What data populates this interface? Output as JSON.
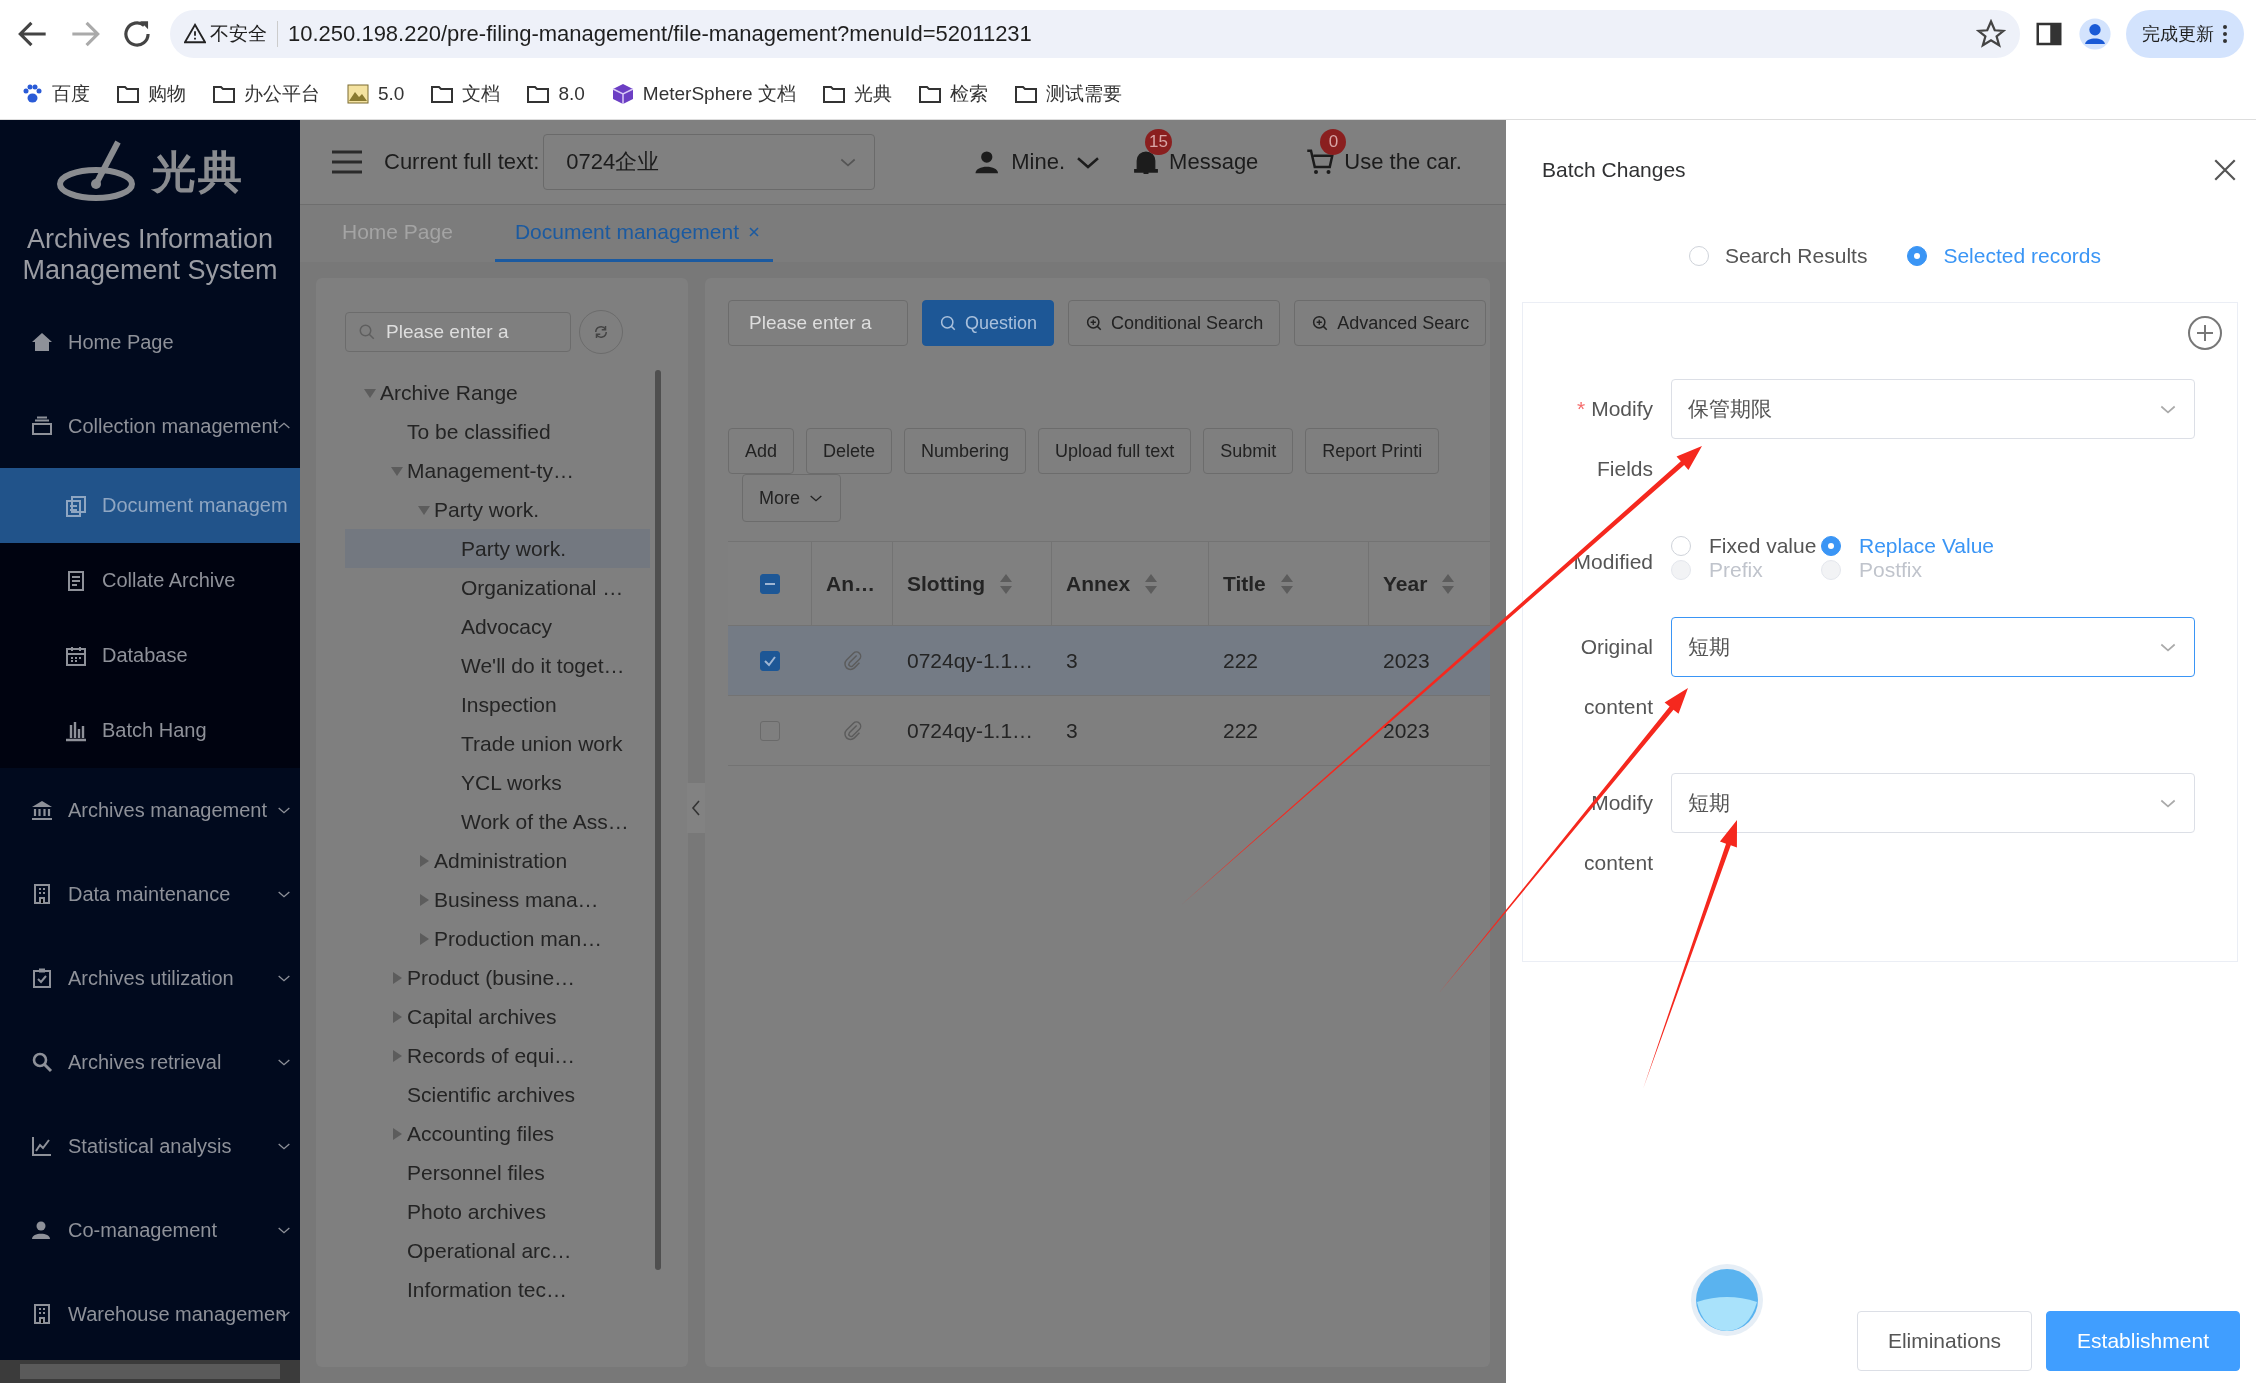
{
  "browser": {
    "security_label": "不安全",
    "url": "10.250.198.220/pre-filing-management/file-management?menuId=52011231",
    "update_button": "完成更新"
  },
  "bookmarks": [
    {
      "label": "百度",
      "kind": "paw"
    },
    {
      "label": "购物",
      "kind": "folder"
    },
    {
      "label": "办公平台",
      "kind": "folder"
    },
    {
      "label": "5.0",
      "kind": "image"
    },
    {
      "label": "文档",
      "kind": "folder"
    },
    {
      "label": "8.0",
      "kind": "folder"
    },
    {
      "label": "MeterSphere 文档",
      "kind": "cube"
    },
    {
      "label": "光典",
      "kind": "folder"
    },
    {
      "label": "检索",
      "kind": "folder"
    },
    {
      "label": "测试需要",
      "kind": "folder"
    }
  ],
  "sidebar": {
    "logo_text": "光典",
    "title": "Archives Information Management System",
    "items": [
      {
        "label": "Home Page",
        "kind": "link",
        "selected": false
      },
      {
        "label": "Collection management",
        "kind": "group",
        "selected": false,
        "expanded": true,
        "children": [
          {
            "label": "Document managem",
            "selected": true
          },
          {
            "label": "Collate Archive",
            "selected": false
          },
          {
            "label": "Database",
            "selected": false
          },
          {
            "label": "Batch Hang",
            "selected": false
          }
        ]
      },
      {
        "label": "Archives management",
        "kind": "group",
        "selected": false,
        "expanded": false
      },
      {
        "label": "Data maintenance",
        "kind": "group",
        "selected": false,
        "expanded": false
      },
      {
        "label": "Archives utilization",
        "kind": "group",
        "selected": false,
        "expanded": false
      },
      {
        "label": "Archives retrieval",
        "kind": "group",
        "selected": false,
        "expanded": false
      },
      {
        "label": "Statistical analysis",
        "kind": "group",
        "selected": false,
        "expanded": false
      },
      {
        "label": "Co-management",
        "kind": "group",
        "selected": false,
        "expanded": false
      },
      {
        "label": "Warehouse managemen",
        "kind": "group",
        "selected": false,
        "expanded": false
      }
    ]
  },
  "header": {
    "full_text_label": "Current full text:",
    "full_text_value": "0724企业",
    "user": "Mine.",
    "message_count": "15",
    "message_label": "Message",
    "cart_count": "0",
    "cart_label": "Use the car."
  },
  "tabs": [
    {
      "label": "Home Page",
      "selected": false
    },
    {
      "label": "Document management",
      "selected": true
    }
  ],
  "tree": {
    "search_placeholder": "Please enter a",
    "nodes": [
      {
        "label": "Archive Range",
        "expanded": true,
        "selected": false,
        "children": [
          {
            "label": "To be classified",
            "selected": false
          },
          {
            "label": "Management-ty…",
            "expanded": true,
            "selected": false,
            "children": [
              {
                "label": "Party work.",
                "expanded": true,
                "selected": false,
                "children": [
                  {
                    "label": "Party work.",
                    "selected": true
                  },
                  {
                    "label": "Organizational …",
                    "selected": false
                  },
                  {
                    "label": "Advocacy",
                    "selected": false
                  },
                  {
                    "label": "We'll do it toget…",
                    "selected": false
                  },
                  {
                    "label": "Inspection",
                    "selected": false
                  },
                  {
                    "label": "Trade union work",
                    "selected": false
                  },
                  {
                    "label": "YCL works",
                    "selected": false
                  },
                  {
                    "label": "Work of the Ass…",
                    "selected": false
                  }
                ]
              },
              {
                "label": "Administration",
                "expanded": false,
                "selected": false
              },
              {
                "label": "Business mana…",
                "expanded": false,
                "selected": false
              },
              {
                "label": "Production man…",
                "expanded": false,
                "selected": false
              }
            ]
          },
          {
            "label": "Product (busine…",
            "expanded": false,
            "selected": false
          },
          {
            "label": "Capital archives",
            "expanded": false,
            "selected": false
          },
          {
            "label": "Records of equi…",
            "expanded": false,
            "selected": false
          },
          {
            "label": "Scientific archives",
            "selected": false
          },
          {
            "label": "Accounting files",
            "expanded": false,
            "selected": false
          },
          {
            "label": "Personnel files",
            "selected": false
          },
          {
            "label": "Photo archives",
            "selected": false
          },
          {
            "label": "Operational arc…",
            "selected": false
          },
          {
            "label": "Information tec…",
            "selected": false
          }
        ]
      }
    ]
  },
  "toolbar": {
    "search_placeholder": "Please enter a",
    "search_buttons": [
      {
        "label": "Question",
        "kind": "primary"
      },
      {
        "label": "Conditional Search",
        "kind": "plain"
      },
      {
        "label": "Advanced Searc",
        "kind": "plain"
      }
    ],
    "actions": [
      {
        "label": "Add",
        "kind": "plain"
      },
      {
        "label": "Delete",
        "kind": "plain"
      },
      {
        "label": "Numbering",
        "kind": "plain"
      },
      {
        "label": "Upload full text",
        "kind": "plain"
      },
      {
        "label": "Submit",
        "kind": "plain"
      },
      {
        "label": "Report Printi",
        "kind": "plain"
      },
      {
        "label": "More",
        "kind": "dropdown"
      }
    ]
  },
  "table": {
    "select_all": {
      "indeterminate": true
    },
    "columns": [
      {
        "label": "An…",
        "sortable": false
      },
      {
        "label": "Slotting",
        "sortable": true
      },
      {
        "label": "Annex",
        "sortable": true
      },
      {
        "label": "Title",
        "sortable": true
      },
      {
        "label": "Year",
        "sortable": true
      }
    ],
    "rows": [
      {
        "selected": true,
        "cells": [
          "",
          "0724qy-1.1…",
          "3",
          "222",
          "2023"
        ]
      },
      {
        "selected": false,
        "cells": [
          "",
          "0724qy-1.1…",
          "3",
          "222",
          "2023"
        ]
      }
    ]
  },
  "drawer": {
    "title": "Batch Changes",
    "scope_options": [
      {
        "label": "Search Results",
        "selected": false
      },
      {
        "label": "Selected records",
        "selected": true
      }
    ],
    "fields": [
      {
        "kind": "select",
        "label": "Modify Fields",
        "required_mark": "*",
        "value": "保管期限",
        "focused": false
      },
      {
        "kind": "radios",
        "label": "Modified",
        "options": [
          {
            "label": "Fixed value",
            "selected": false,
            "disabled": false
          },
          {
            "label": "Replace Value",
            "selected": true,
            "disabled": false
          },
          {
            "label": "Prefix",
            "selected": false,
            "disabled": true
          },
          {
            "label": "Postfix",
            "selected": false,
            "disabled": true
          }
        ]
      },
      {
        "kind": "select",
        "label": "Original content",
        "value": "短期",
        "focused": true
      },
      {
        "kind": "select",
        "label": "Modify content",
        "value": "短期",
        "focused": false
      }
    ],
    "buttons": [
      {
        "label": "Eliminations",
        "kind": "plain"
      },
      {
        "label": "Establishment",
        "kind": "primary"
      }
    ]
  }
}
